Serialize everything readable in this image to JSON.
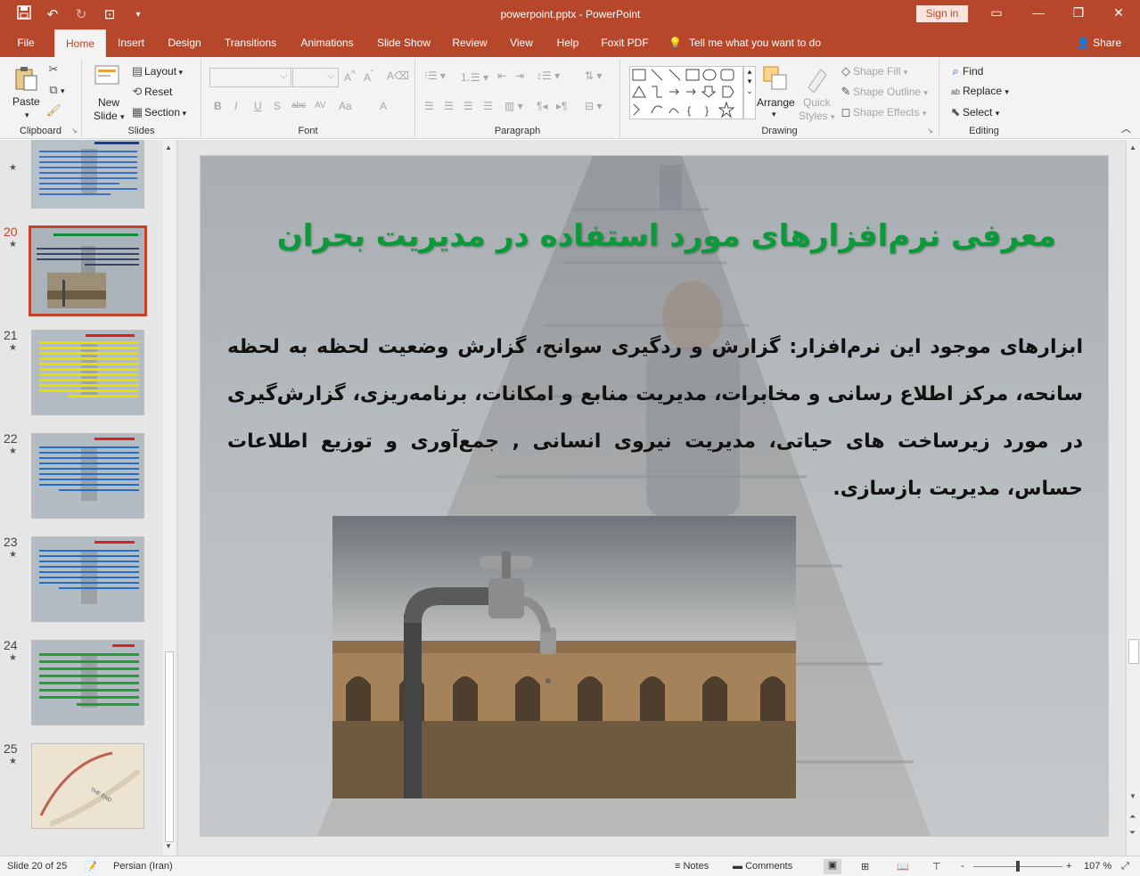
{
  "window": {
    "title": "powerpoint.pptx  -  PowerPoint",
    "sign_in": "Sign in"
  },
  "tabs": [
    "File",
    "Home",
    "Insert",
    "Design",
    "Transitions",
    "Animations",
    "Slide Show",
    "Review",
    "View",
    "Help",
    "Foxit PDF"
  ],
  "tell_me": "Tell me what you want to do",
  "share": "Share",
  "ribbon": {
    "clipboard": {
      "paste": "Paste",
      "label": "Clipboard"
    },
    "slides": {
      "new_slide_1": "New",
      "new_slide_2": "Slide",
      "layout": "Layout",
      "reset": "Reset",
      "section": "Section",
      "label": "Slides"
    },
    "font": {
      "label": "Font",
      "bold": "B",
      "italic": "I",
      "underline": "U",
      "shadow": "S",
      "strike": "abc",
      "spacing": "AV",
      "case": "Aa",
      "color": "A"
    },
    "paragraph": {
      "label": "Paragraph"
    },
    "drawing": {
      "arrange": "Arrange",
      "quick_1": "Quick",
      "quick_2": "Styles",
      "shape_fill": "Shape Fill",
      "shape_outline": "Shape Outline",
      "shape_effects": "Shape Effects",
      "label": "Drawing"
    },
    "editing": {
      "find": "Find",
      "replace": "Replace",
      "select": "Select",
      "label": "Editing"
    }
  },
  "thumbnails": [
    {
      "num": "",
      "star": "★"
    },
    {
      "num": "20",
      "star": "★"
    },
    {
      "num": "21",
      "star": "★"
    },
    {
      "num": "22",
      "star": "★"
    },
    {
      "num": "23",
      "star": "★"
    },
    {
      "num": "24",
      "star": "★"
    },
    {
      "num": "25",
      "star": "★"
    }
  ],
  "slide": {
    "title": "معرفی نرم‌افزارهای مورد استفاده در مدیریت بحران",
    "body": "ابزارهای موجود این نرم‌افزار: گزارش و ردگیری سوانح، گزارش وضعیت لحظه به لحظه سانحه، مرکز اطلاع رسانی و مخابرات، مدیریت منابع و امکانات، برنامه‌ریزی، گزارش‌گیری در مورد زیرساخت های حیاتی، مدیریت نیروی انسانی , جمع‌آوری و توزیع اطلاعات حساس، مدیریت بازسازی."
  },
  "status": {
    "slide_info": "Slide 20 of 25",
    "language": "Persian (Iran)",
    "notes": "Notes",
    "comments": "Comments",
    "zoom": "107 %",
    "zoom_minus": "-",
    "zoom_plus": "+"
  },
  "colors": {
    "accent": "#b7472a",
    "title_green": "#0b9a3a"
  }
}
